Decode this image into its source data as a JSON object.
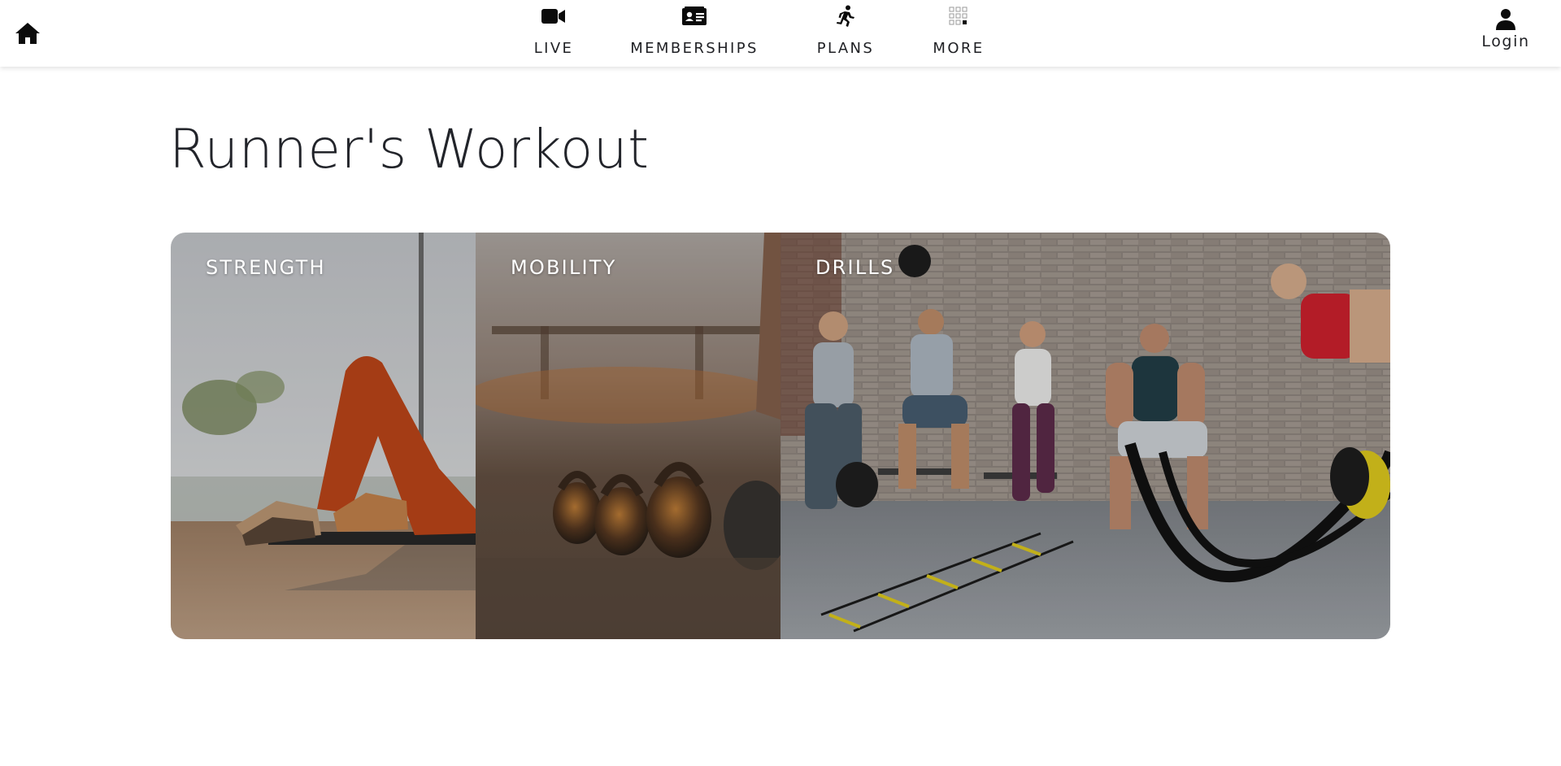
{
  "nav": {
    "items": [
      {
        "label": "LIVE",
        "icon": "video-camera-icon"
      },
      {
        "label": "MEMBERSHIPS",
        "icon": "id-card-icon"
      },
      {
        "label": "PLANS",
        "icon": "running-person-icon"
      },
      {
        "label": "MORE",
        "icon": "grid-icon"
      }
    ],
    "home_icon": "home-icon",
    "login": {
      "label": "Login",
      "icon": "user-icon"
    }
  },
  "page": {
    "title": "Runner's Workout"
  },
  "cards": [
    {
      "label": "STRENGTH"
    },
    {
      "label": "MOBILITY"
    },
    {
      "label": "DRILLS"
    }
  ],
  "colors": {
    "text": "#1f2024",
    "card_label": "#ffffff",
    "navbar_bg": "#ffffff",
    "ladder_yellow": "#d8c51c"
  }
}
